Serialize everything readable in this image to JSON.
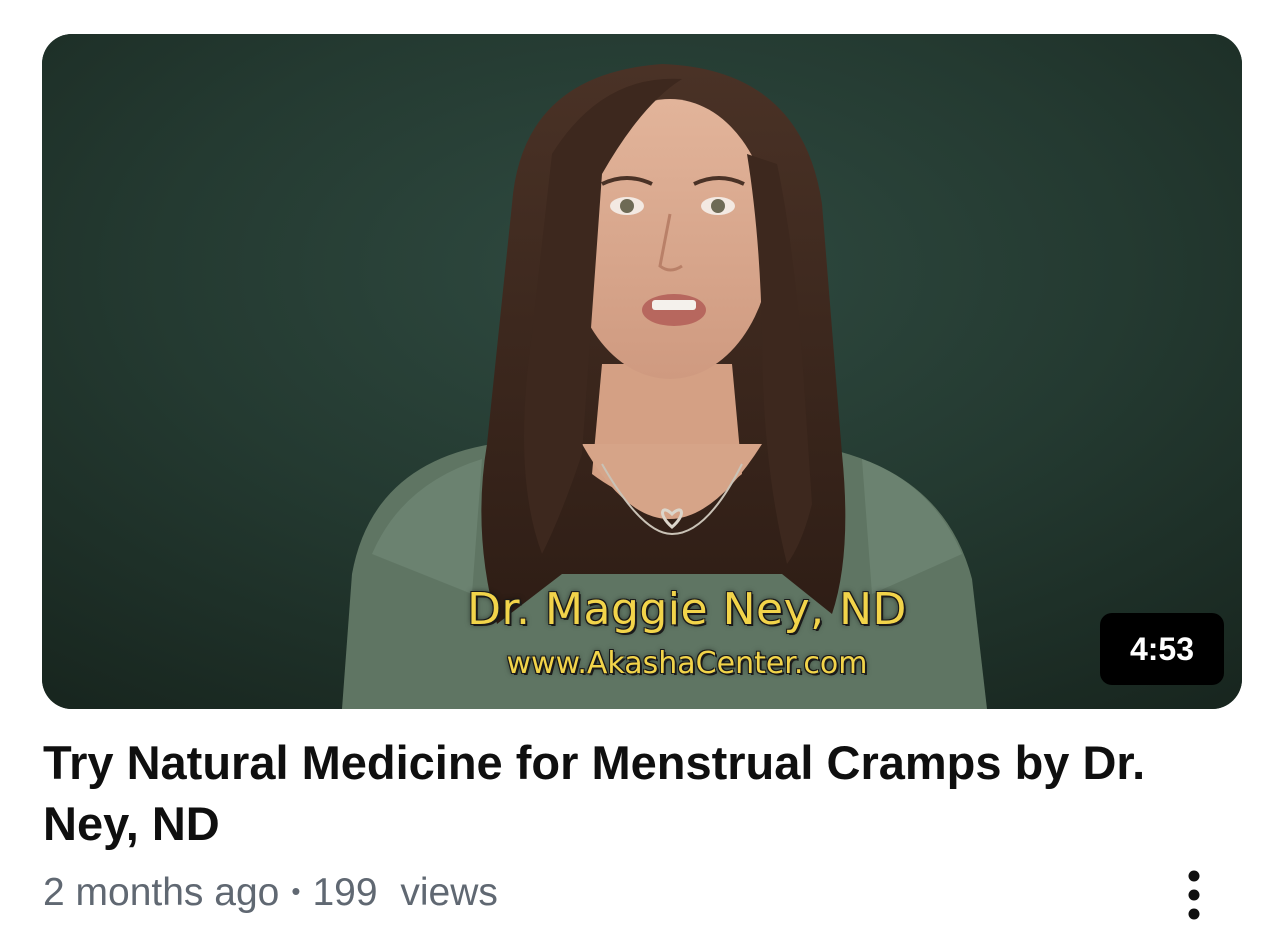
{
  "video": {
    "title": "Try Natural Medicine for Menstrual Cramps by Dr. Ney, ND",
    "duration": "4:53",
    "thumbnail": {
      "caption_name": "Dr. Maggie Ney, ND",
      "caption_url": "www.AkashaCenter.com"
    },
    "meta": {
      "age": "2 months ago",
      "separator": "•",
      "view_count": "199",
      "views_label": "views"
    },
    "more_icon": "vertical-ellipsis-icon"
  },
  "colors": {
    "title": "#0f0f0f",
    "meta": "#606872",
    "caption": "#f2d44a",
    "badge_bg": "#000000"
  }
}
